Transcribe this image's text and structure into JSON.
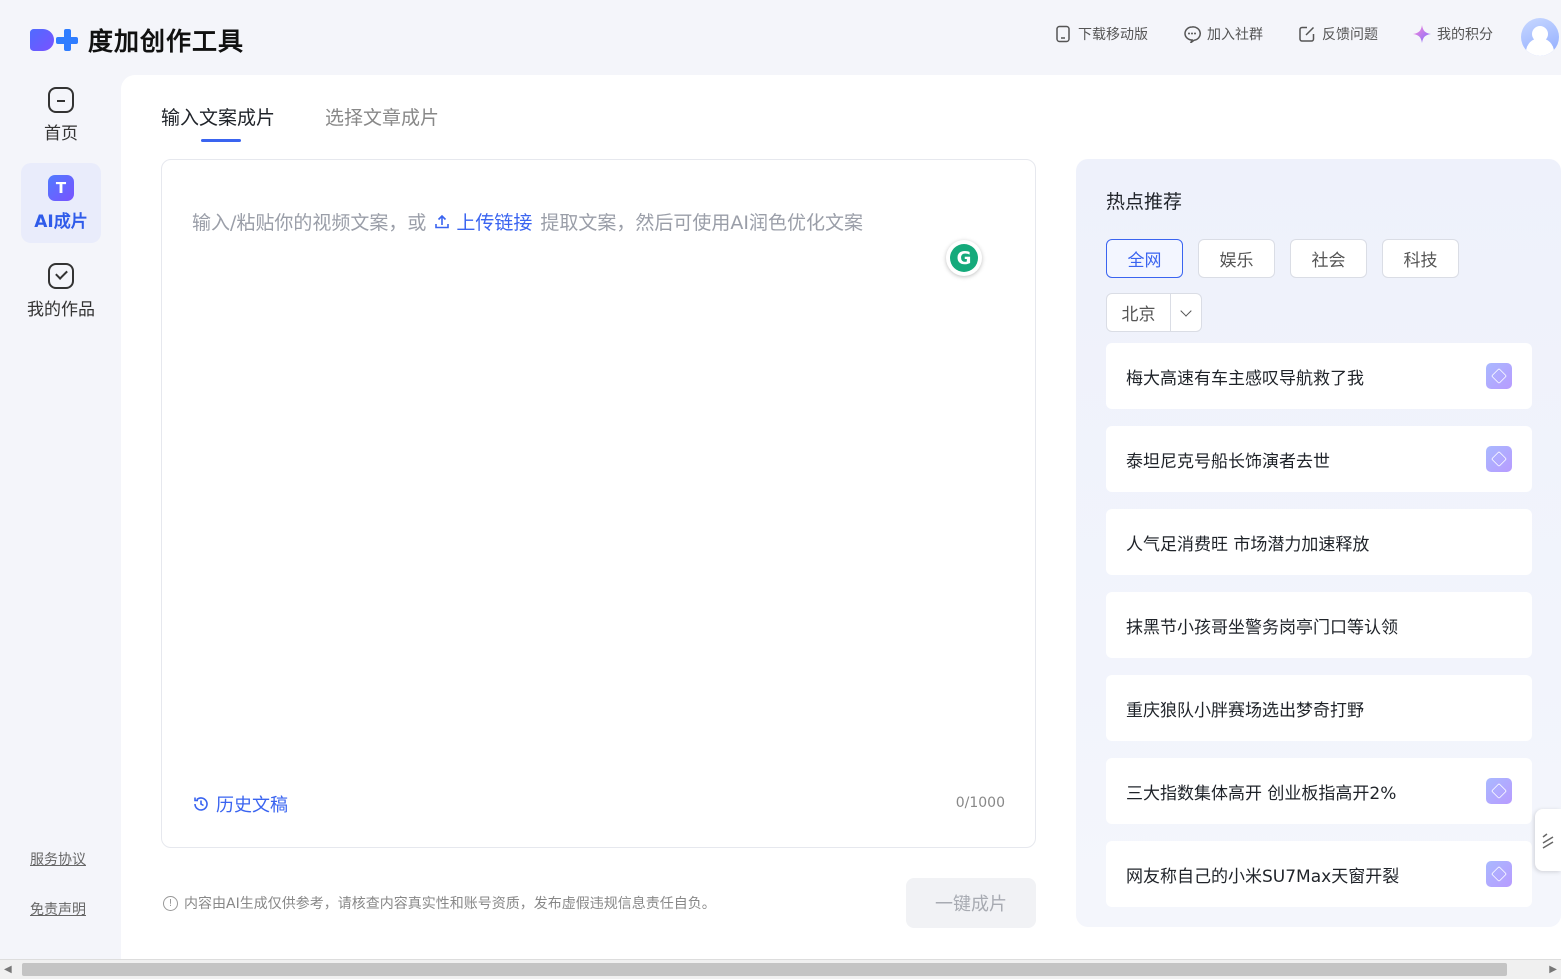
{
  "app": {
    "logo_text": "度加创作工具"
  },
  "header": {
    "actions": [
      {
        "label": "下载移动版",
        "icon": "mobile-icon"
      },
      {
        "label": "加入社群",
        "icon": "chat-icon"
      },
      {
        "label": "反馈问题",
        "icon": "edit-icon"
      },
      {
        "label": "我的积分",
        "icon": "sparkle-icon"
      }
    ]
  },
  "sidebar": {
    "items": [
      {
        "label": "首页",
        "icon": "home-icon"
      },
      {
        "label": "AI成片",
        "icon": "ai-icon",
        "icon_text": "T",
        "active": true
      },
      {
        "label": "我的作品",
        "icon": "works-icon"
      }
    ],
    "links": [
      "服务协议",
      "免责声明"
    ]
  },
  "tabs": [
    "输入文案成片",
    "选择文章成片"
  ],
  "editor": {
    "placeholder_before": "输入/粘贴你的视频文案，或",
    "upload_link": "上传链接",
    "placeholder_after": "提取文案，然后可使用AI润色优化文案",
    "history": "历史文稿",
    "counter": "0/1000",
    "grammarly_letter": "G"
  },
  "footer": {
    "notice": "内容由AI生成仅供参考，请核查内容真实性和账号资质，发布虚假违规信息责任自负。",
    "submit": "一键成片"
  },
  "hot": {
    "title": "热点推荐",
    "filters": [
      "全网",
      "娱乐",
      "社会",
      "科技"
    ],
    "active_filter": "全网",
    "city": "北京",
    "items": [
      {
        "text": "梅大高速有车主感叹导航救了我",
        "badge": true
      },
      {
        "text": "泰坦尼克号船长饰演者去世",
        "badge": true
      },
      {
        "text": "人气足消费旺 市场潜力加速释放",
        "badge": false
      },
      {
        "text": "抹黑节小孩哥坐警务岗亭门口等认领",
        "badge": false
      },
      {
        "text": "重庆狼队小胖赛场选出梦奇打野",
        "badge": false
      },
      {
        "text": "三大指数集体高开 创业板指高开2%",
        "badge": true
      },
      {
        "text": "网友称自己的小米SU7Max天窗开裂",
        "badge": true
      }
    ]
  },
  "colors": {
    "accent": "#3a64f0",
    "active_nav_bg": "#e9ecfb"
  }
}
